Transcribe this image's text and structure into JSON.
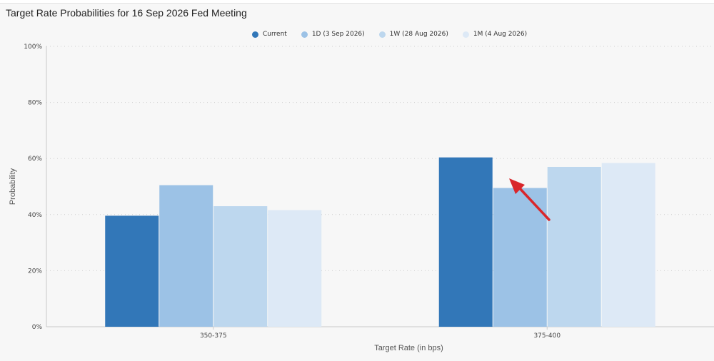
{
  "title": "Target Rate Probabilities for 16 Sep 2026 Fed Meeting",
  "colors": {
    "current": "#3277b8",
    "d1": "#9cc2e6",
    "w1": "#bdd7ee",
    "m1": "#dde9f6",
    "arrow": "#d9262b"
  },
  "legend": [
    {
      "label": "Current",
      "color": "#3277b8"
    },
    {
      "label": "1D (3 Sep 2026)",
      "color": "#9cc2e6"
    },
    {
      "label": "1W (28 Aug 2026)",
      "color": "#bdd7ee"
    },
    {
      "label": "1M (4 Aug 2026)",
      "color": "#dde9f6"
    }
  ],
  "chart_data": {
    "type": "bar",
    "title": "Target Rate Probabilities for 16 Sep 2026 Fed Meeting",
    "xlabel": "Target Rate (in bps)",
    "ylabel": "Probability",
    "ylim": [
      0,
      100
    ],
    "yticks": [
      "0%",
      "20%",
      "40%",
      "60%",
      "80%",
      "100%"
    ],
    "categories": [
      "350-375",
      "375-400"
    ],
    "series": [
      {
        "name": "Current",
        "values": [
          39.6,
          60.4
        ],
        "color": "#3277b8"
      },
      {
        "name": "1D (3 Sep 2026)",
        "values": [
          50.5,
          49.5
        ],
        "color": "#9cc2e6"
      },
      {
        "name": "1W (28 Aug 2026)",
        "values": [
          43.0,
          57.0
        ],
        "color": "#bdd7ee"
      },
      {
        "name": "1M (4 Aug 2026)",
        "values": [
          41.6,
          58.4
        ],
        "color": "#dde9f6"
      }
    ],
    "grid": true,
    "legend_position": "top-center",
    "annotation": "red arrow pointing at Current bar for 375-400"
  }
}
